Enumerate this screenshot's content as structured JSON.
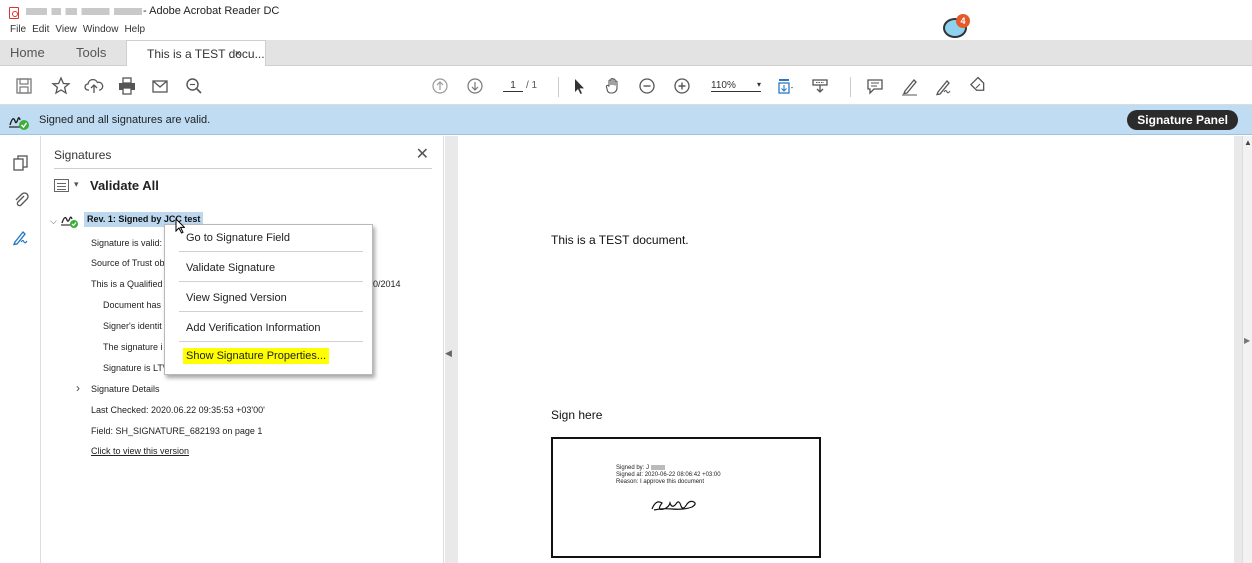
{
  "window": {
    "title_suffix": "- Adobe Acrobat Reader DC",
    "assistant_badge_count": "4"
  },
  "menu": [
    "File",
    "Edit",
    "View",
    "Window",
    "Help"
  ],
  "tabs": {
    "home": "Home",
    "tools": "Tools",
    "document": "This is a TEST docu...",
    "close": "×"
  },
  "toolbar": {
    "page_current": "1",
    "page_total": "/ 1",
    "zoom": "110%",
    "zoom_caret": "▾"
  },
  "signature_bar": {
    "status": "Signed and all signatures are valid.",
    "panel_button": "Signature Panel"
  },
  "panel": {
    "title": "Signatures",
    "close": "✕",
    "validate_all": "Validate All",
    "revision": "Rev. 1: Signed by JCC test",
    "rows": [
      "Signature is valid:",
      "Source of Trust ob",
      "This is a Qualified",
      "Document has",
      "Signer's identit",
      "The signature i",
      "Signature is LT\\",
      "Signature Details",
      "Last Checked: 2020.06.22 09:35:53 +03'00'",
      "Field: SH_SIGNATURE_682193 on page 1",
      "Click to view this version"
    ],
    "qualified_suffix": "0/2014"
  },
  "context_menu": {
    "items": [
      "Go to Signature Field",
      "Validate Signature",
      "View Signed Version",
      "Add Verification Information",
      "Show Signature Properties..."
    ],
    "highlight_color": "#ffff00"
  },
  "document": {
    "line1": "This is a TEST document.",
    "line2": "Sign here",
    "signature": {
      "signed_by": "Signed by: J",
      "signed_at": "Signed at: 2020-06-22 08:06:42 +03:00",
      "reason": "Reason: I approve this document"
    }
  },
  "colors": {
    "signature_bar": "#bfdcf3",
    "selection": "#bcd7ee",
    "valid_check": "#3cae3c"
  }
}
